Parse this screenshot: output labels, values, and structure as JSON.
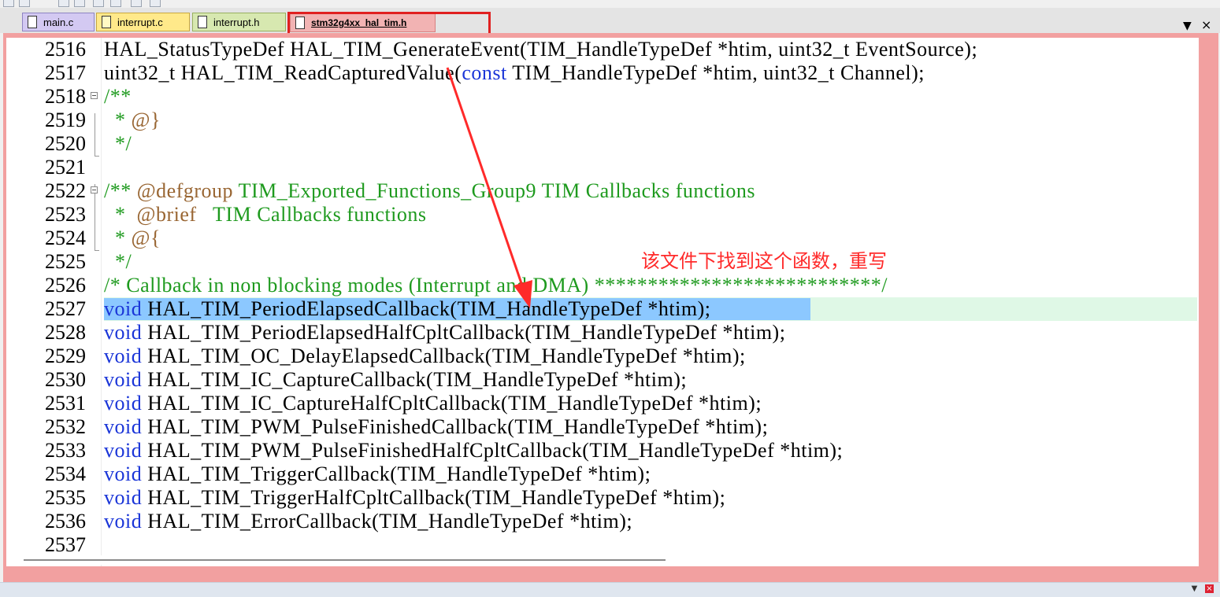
{
  "tabs": [
    {
      "label": "main.c"
    },
    {
      "label": "interrupt.c"
    },
    {
      "label": "interrupt.h"
    },
    {
      "label": "stm32g4xx_hal_tim.h",
      "active": true
    }
  ],
  "tab_controls": {
    "dropdown": "▼",
    "close": "×"
  },
  "annotation": "该文件下找到这个函数，重写",
  "lines": [
    {
      "num": "2516",
      "text": "HAL_StatusTypeDef HAL_TIM_GenerateEvent(TIM_HandleTypeDef *htim, uint32_t EventSource);"
    },
    {
      "num": "2517",
      "text_a": "uint32_t HAL_TIM_ReadCapturedValue(",
      "kw": "const",
      "text_b": " TIM_HandleTypeDef *htim, uint32_t Channel);"
    },
    {
      "num": "2518",
      "text": "/**"
    },
    {
      "num": "2519",
      "text_a": "  * ",
      "text_b": "@}"
    },
    {
      "num": "2520",
      "text": "  */"
    },
    {
      "num": "2521",
      "text": ""
    },
    {
      "num": "2522",
      "text_a": "/** ",
      "text_b": "@defgroup",
      "text_c": " TIM_Exported_Functions_Group9 TIM Callbacks functions"
    },
    {
      "num": "2523",
      "text_a": "  *  ",
      "text_b": "@brief",
      "text_c": "   TIM Callbacks functions"
    },
    {
      "num": "2524",
      "text_a": "  * ",
      "text_b": "@{"
    },
    {
      "num": "2525",
      "text": "  */"
    },
    {
      "num": "2526",
      "text": "/* Callback in non blocking modes (Interrupt and DMA) ***************************/"
    },
    {
      "num": "2527",
      "kw": "void",
      "text": " HAL_TIM_PeriodElapsedCallback(TIM_HandleTypeDef *htim);"
    },
    {
      "num": "2528",
      "kw": "void",
      "text": " HAL_TIM_PeriodElapsedHalfCpltCallback(TIM_HandleTypeDef *htim);"
    },
    {
      "num": "2529",
      "kw": "void",
      "text": " HAL_TIM_OC_DelayElapsedCallback(TIM_HandleTypeDef *htim);"
    },
    {
      "num": "2530",
      "kw": "void",
      "text": " HAL_TIM_IC_CaptureCallback(TIM_HandleTypeDef *htim);"
    },
    {
      "num": "2531",
      "kw": "void",
      "text": " HAL_TIM_IC_CaptureHalfCpltCallback(TIM_HandleTypeDef *htim);"
    },
    {
      "num": "2532",
      "kw": "void",
      "text": " HAL_TIM_PWM_PulseFinishedCallback(TIM_HandleTypeDef *htim);"
    },
    {
      "num": "2533",
      "kw": "void",
      "text": " HAL_TIM_PWM_PulseFinishedHalfCpltCallback(TIM_HandleTypeDef *htim);"
    },
    {
      "num": "2534",
      "kw": "void",
      "text": " HAL_TIM_TriggerCallback(TIM_HandleTypeDef *htim);"
    },
    {
      "num": "2535",
      "kw": "void",
      "text": " HAL_TIM_TriggerHalfCpltCallback(TIM_HandleTypeDef *htim);"
    },
    {
      "num": "2536",
      "kw": "void",
      "text": " HAL_TIM_ErrorCallback(TIM_HandleTypeDef *htim);"
    },
    {
      "num": "2537",
      "text": ""
    }
  ],
  "colors": {
    "keyword": "#1a35d8",
    "comment": "#1e9a1e",
    "doc_tag": "#996633",
    "annotation": "#ff2a2a",
    "highlight_row": "#dff8e6",
    "selection": "#8cc8ff"
  }
}
